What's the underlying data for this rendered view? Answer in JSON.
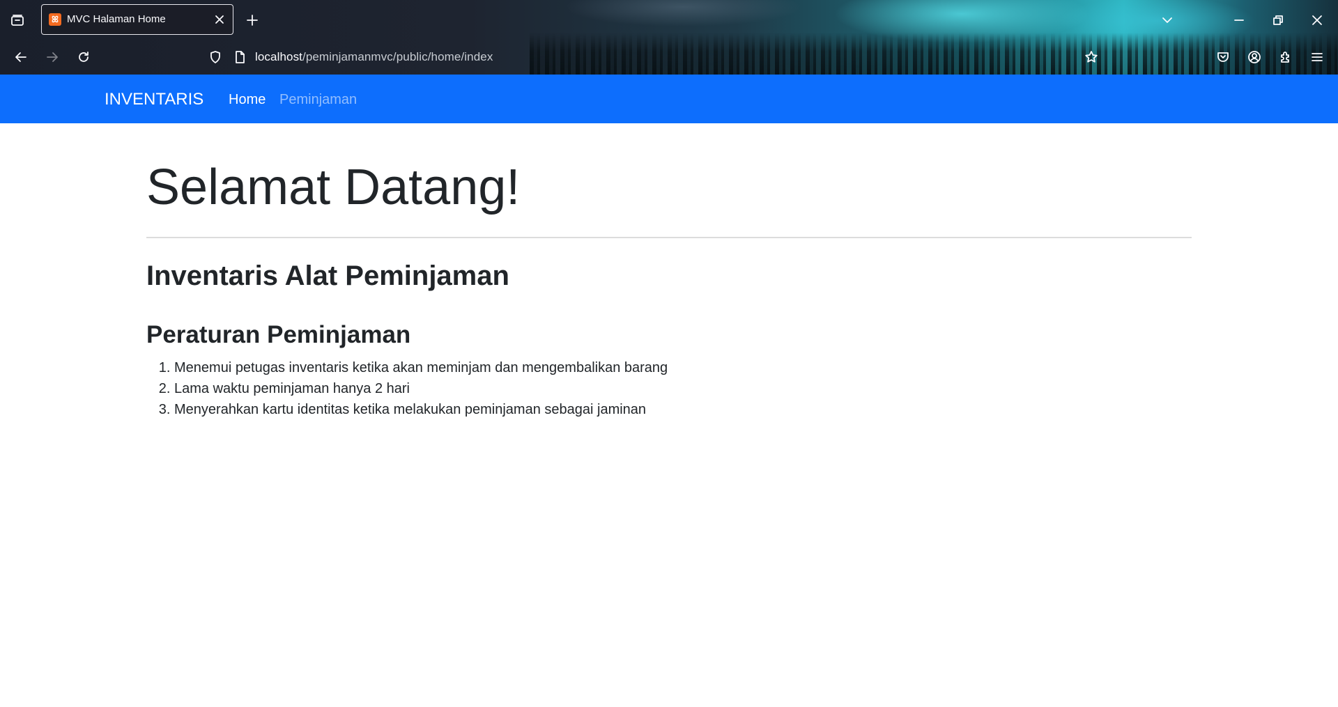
{
  "browser": {
    "tab_title": "MVC Halaman Home",
    "favicon_glyph": "ꕤ",
    "url_host": "localhost",
    "url_path": "/peminjamanmvc/public/home/index",
    "icons": [
      "tab-list-icon",
      "new-tab-icon",
      "back-icon",
      "forward-icon",
      "reload-icon",
      "shield-icon",
      "page-icon",
      "star-icon",
      "pocket-icon",
      "account-icon",
      "extensions-icon",
      "menu-icon",
      "chevron-down-icon",
      "minimize-icon",
      "restore-icon",
      "close-icon"
    ]
  },
  "navbar": {
    "brand": "INVENTARIS",
    "links": [
      {
        "label": "Home",
        "active": true
      },
      {
        "label": "Peminjaman",
        "active": false
      }
    ],
    "color": "#0d6efd"
  },
  "main": {
    "heading": "Selamat Datang!",
    "subtitle": "Inventaris Alat Peminjaman",
    "rules_title": "Peraturan Peminjaman",
    "rules": [
      "Menemui petugas inventaris ketika akan meminjam dan mengembalikan barang",
      "Lama waktu peminjaman hanya 2 hari",
      "Menyerahkan kartu identitas ketika melakukan peminjaman sebagai jaminan"
    ]
  }
}
